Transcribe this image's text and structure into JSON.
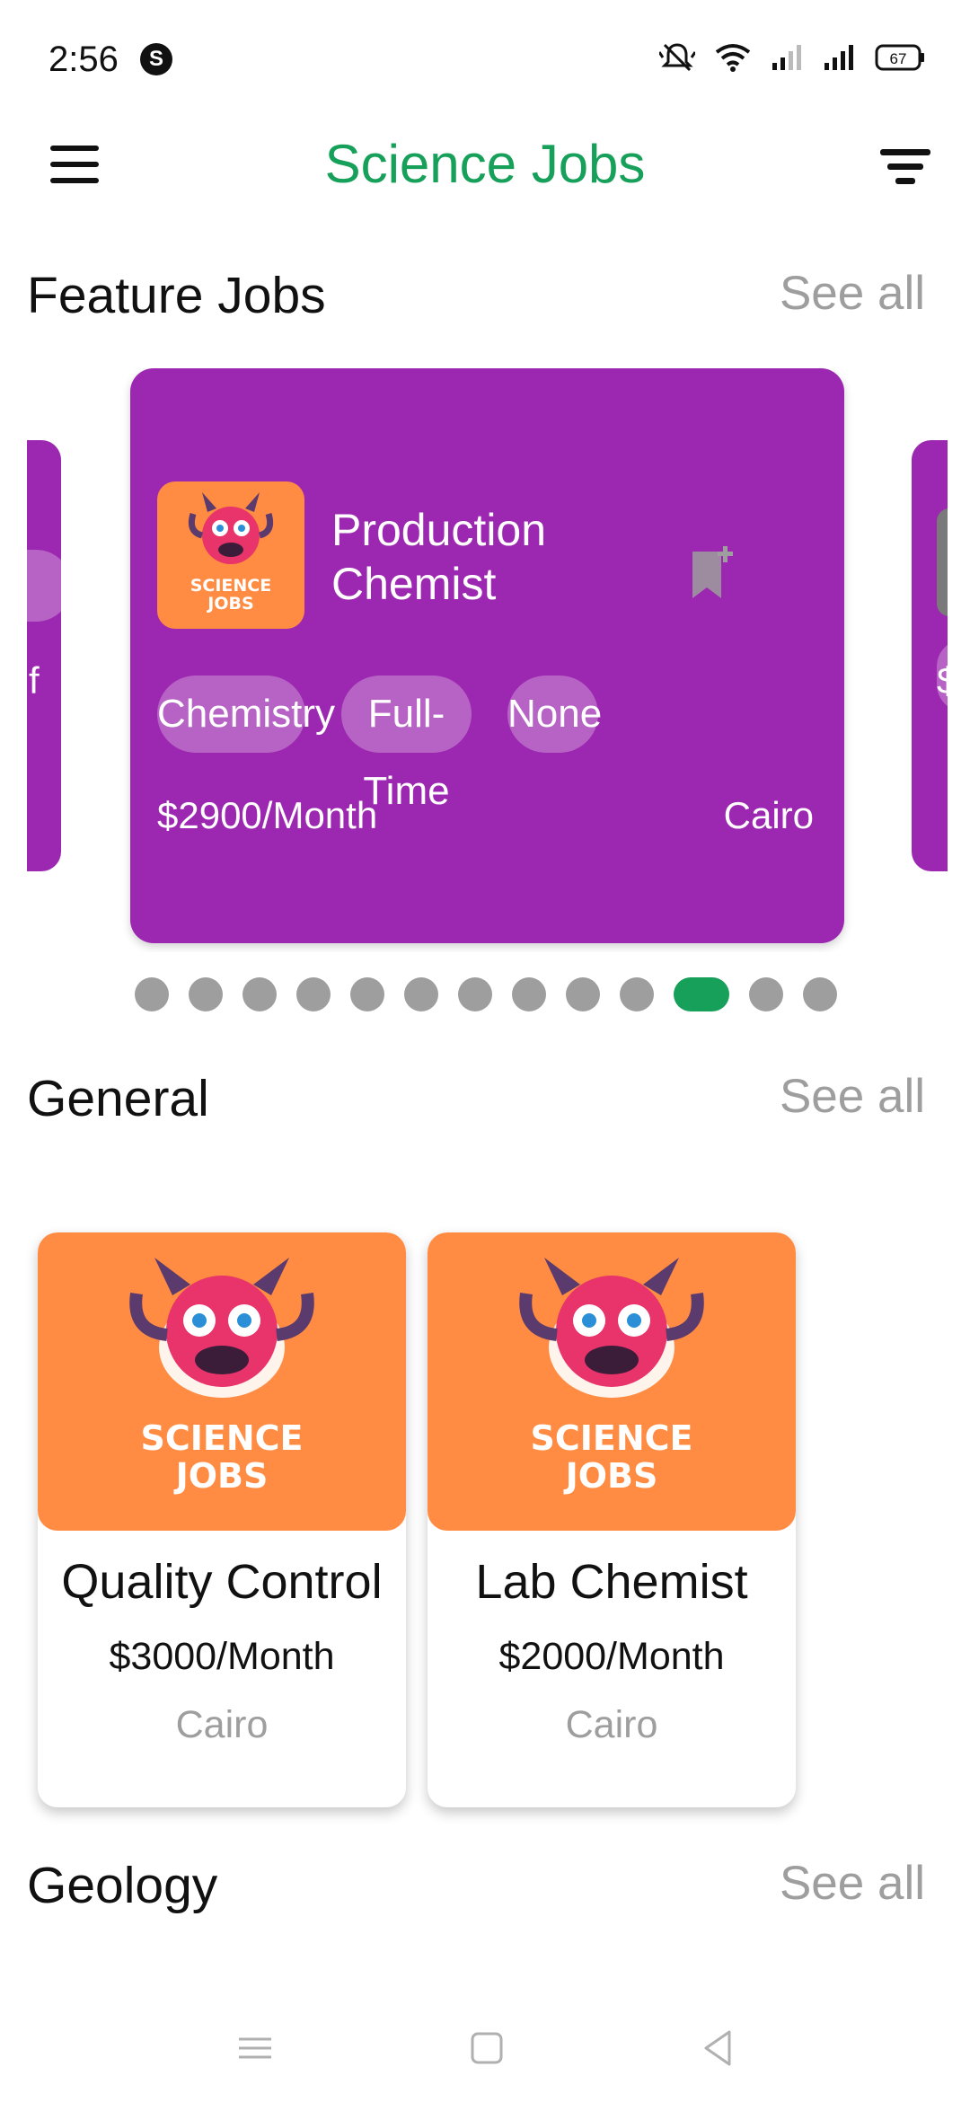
{
  "status_bar": {
    "time": "2:56",
    "app_badge": "S",
    "battery": "67"
  },
  "app_bar": {
    "title": "Science Jobs"
  },
  "featured": {
    "title": "Feature Jobs",
    "see_all": "See all",
    "left_peek_text": "f",
    "right_peek_text": "$",
    "card": {
      "logo_line1": "SCIENCE",
      "logo_line2": "JOBS",
      "title": "Production Chemist",
      "chips": [
        "Chemistry",
        "Full-Time",
        "None"
      ],
      "salary": "$2900/Month",
      "location": "Cairo"
    },
    "dots_total": 13,
    "dots_active_index": 10
  },
  "general": {
    "title": "General",
    "see_all": "See all",
    "cards": [
      {
        "logo_line1": "SCIENCE",
        "logo_line2": "JOBS",
        "title": "Quality Control",
        "salary": "$3000/Month",
        "location": "Cairo"
      },
      {
        "logo_line1": "SCIENCE",
        "logo_line2": "JOBS",
        "title": "Lab Chemist",
        "salary": "$2000/Month",
        "location": "Cairo"
      }
    ]
  },
  "geology": {
    "title": "Geology",
    "see_all": "See all"
  },
  "colors": {
    "brand_green": "#16a05a",
    "card_purple": "#9c27b0",
    "logo_orange": "#ff8c42",
    "muted_gray": "#9e9e9e"
  },
  "icons": [
    "menu-icon",
    "filter-icon",
    "bookmark-add-icon",
    "mute-icon",
    "wifi-icon",
    "signal-icon",
    "battery-icon",
    "nav-menu-icon",
    "nav-home-icon",
    "nav-back-icon"
  ]
}
